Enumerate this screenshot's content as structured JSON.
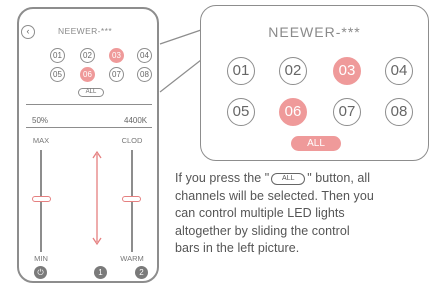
{
  "phone": {
    "back_icon": "back-arrow-icon",
    "device_name": "NEEWER-***",
    "channels": [
      {
        "label": "01",
        "selected": false
      },
      {
        "label": "02",
        "selected": false
      },
      {
        "label": "03",
        "selected": true
      },
      {
        "label": "04",
        "selected": false
      },
      {
        "label": "05",
        "selected": false
      },
      {
        "label": "06",
        "selected": true
      },
      {
        "label": "07",
        "selected": false
      },
      {
        "label": "08",
        "selected": false
      }
    ],
    "all_label": "ALL",
    "brightness": "50%",
    "color_temp": "4400K",
    "sliders": {
      "left_top_label": "MAX",
      "left_bottom_label": "MIN",
      "right_top_label": "CLOD",
      "right_bottom_label": "WARM"
    },
    "tabs": [
      {
        "icon": "power-icon",
        "label": "⏻"
      },
      {
        "label": "1"
      },
      {
        "label": "2"
      }
    ]
  },
  "zoom": {
    "device_name": "NEEWER-***",
    "channels": [
      {
        "label": "01",
        "selected": false
      },
      {
        "label": "02",
        "selected": false
      },
      {
        "label": "03",
        "selected": true
      },
      {
        "label": "04",
        "selected": false
      },
      {
        "label": "05",
        "selected": false
      },
      {
        "label": "06",
        "selected": true
      },
      {
        "label": "07",
        "selected": false
      },
      {
        "label": "08",
        "selected": false
      }
    ],
    "all_label": "ALL"
  },
  "description": {
    "line1_a": "If you press the \"",
    "button_label": "ALL",
    "line1_b": "\" button, all",
    "line2": "channels will be selected. Then you",
    "line3": "can control multiple LED lights",
    "line4": "altogether by sliding the control",
    "line5": "bars in the left picture."
  },
  "colors": {
    "accent": "#ef9a9a",
    "outline": "#8d8d8d"
  }
}
